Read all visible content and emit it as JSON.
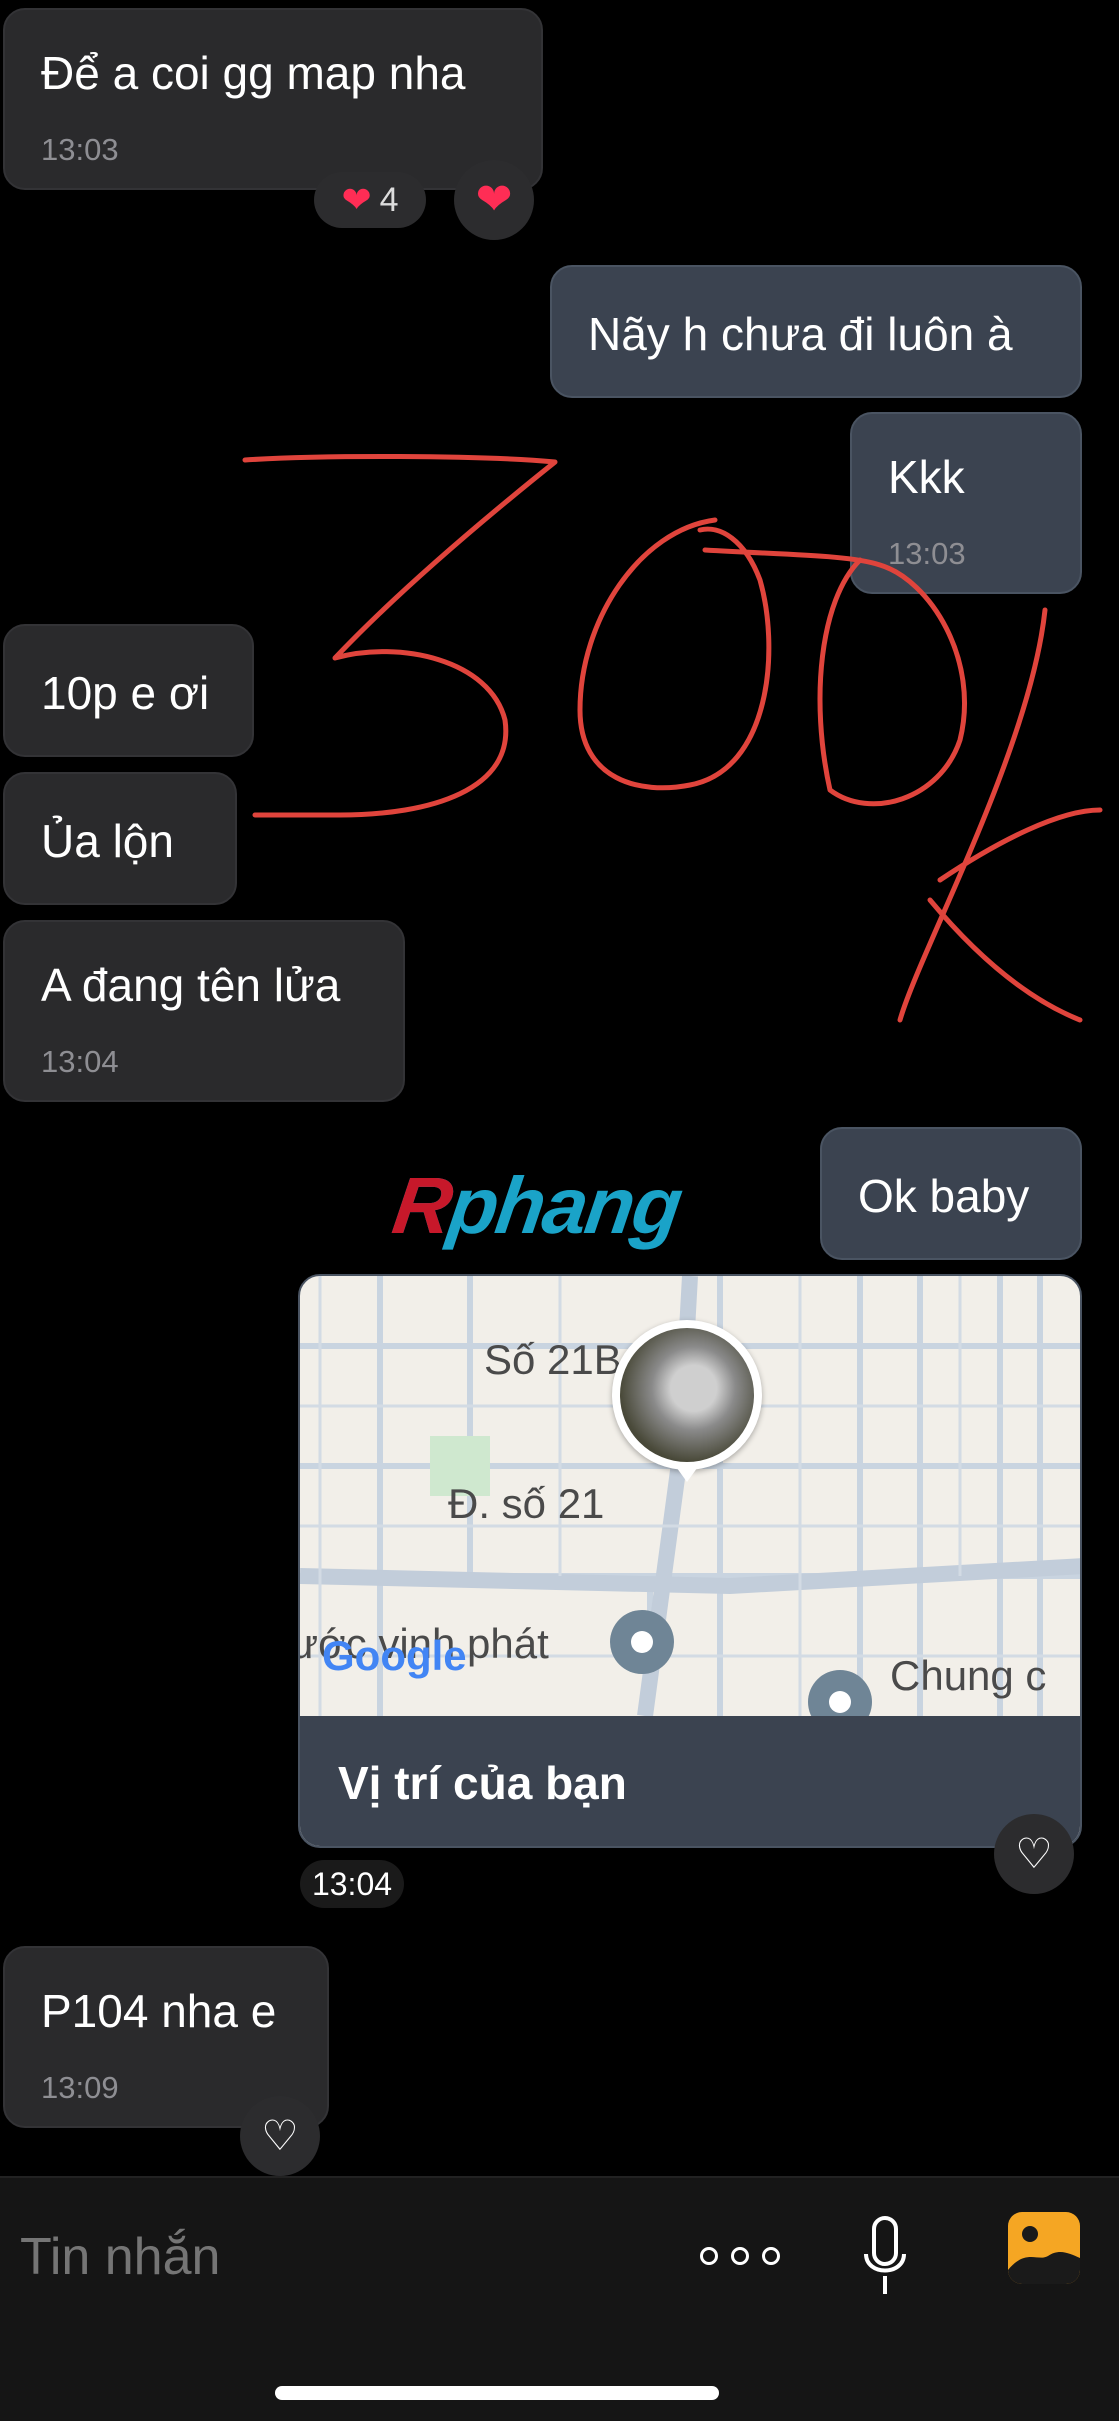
{
  "messages": [
    {
      "id": "m1",
      "side": "in",
      "text": "Để a coi gg map nha",
      "time": "13:03"
    },
    {
      "id": "m2",
      "side": "out",
      "text": "Nãy h chưa đi luôn à"
    },
    {
      "id": "m3",
      "side": "out",
      "text": "Kkk",
      "time": "13:03"
    },
    {
      "id": "m4",
      "side": "in",
      "text": "10p e ơi"
    },
    {
      "id": "m5",
      "side": "in",
      "text": "Ủa lộn"
    },
    {
      "id": "m6",
      "side": "in",
      "text": "A đang tên lửa",
      "time": "13:04"
    },
    {
      "id": "m7",
      "side": "out",
      "text": "Ok baby"
    },
    {
      "id": "m9",
      "side": "in",
      "text": "P104 nha e",
      "time": "13:09"
    }
  ],
  "reaction": {
    "emoji": "❤️",
    "count": "4"
  },
  "location": {
    "caption": "Vị trí của bạn",
    "time": "13:04",
    "map_labels": [
      "Số 21B",
      "Đ. số 21",
      "ước vinh phát",
      "Chung c"
    ],
    "google": "Google"
  },
  "watermark": "Rphang",
  "handwriting": "300k",
  "input": {
    "placeholder": "Tin nhắn"
  },
  "colors": {
    "outgoing": "#3b4350",
    "incoming": "#2a2a2c",
    "ink": "#e0443c",
    "accent": "#f5a623"
  }
}
